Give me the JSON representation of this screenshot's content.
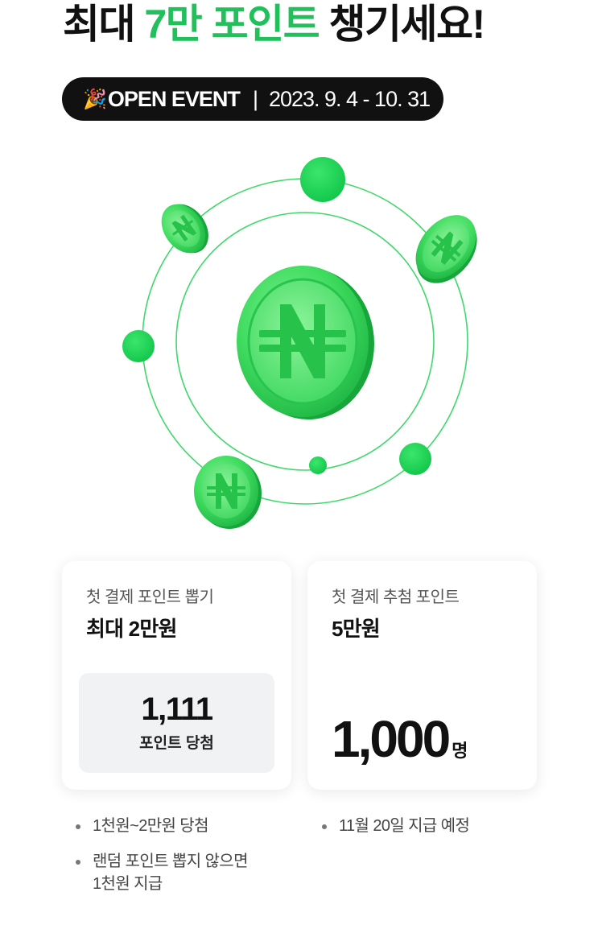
{
  "headline": {
    "prefix": "최대 ",
    "highlight": "7만 포인트",
    "suffix": " 챙기세요!",
    "accent_color": "#20c15a"
  },
  "event_pill": {
    "icon": "party-popper-icon",
    "emoji": "🎉",
    "label": "OPEN EVENT",
    "separator": "|",
    "period": "2023. 9. 4 - 10. 31"
  },
  "illustration": {
    "coin_symbol": "N-won-coin-icon",
    "coin_color": "#2ed35c"
  },
  "cards": [
    {
      "subtitle": "첫 결제 포인트 뽑기",
      "title": "최대 2만원",
      "winner_count": "1,111",
      "winner_caption": "포인트 당첨",
      "bullets": [
        [
          "1천원~2만원 당첨"
        ],
        [
          "랜덤 포인트 뽑지 않으면",
          "1천원 지급"
        ]
      ]
    },
    {
      "subtitle": "첫 결제 추첨 포인트",
      "title": "5만원",
      "winner_count": "1,000",
      "winner_unit": "명",
      "bullets": [
        [
          "11월 20일 지급 예정"
        ]
      ]
    }
  ]
}
